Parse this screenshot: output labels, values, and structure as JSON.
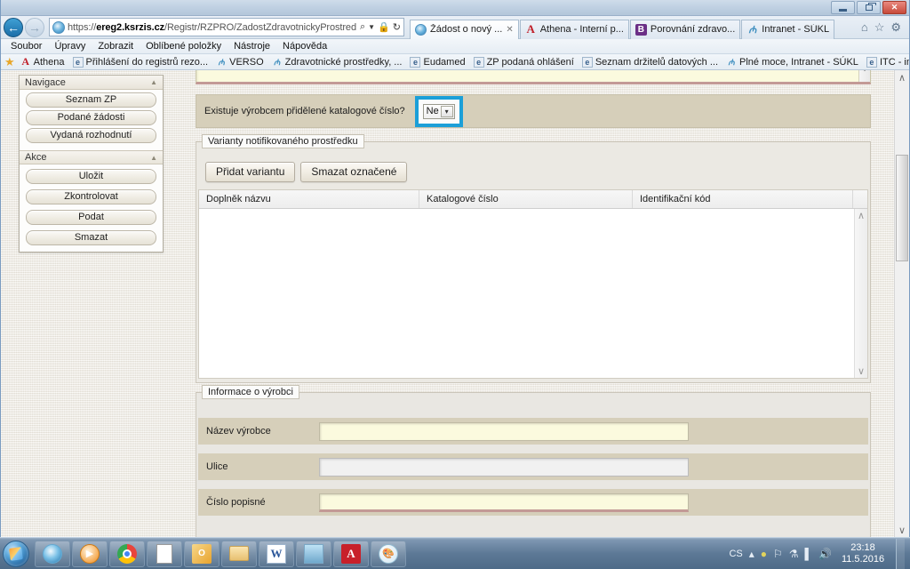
{
  "window": {
    "minimize_label": "—",
    "restore_label": "❐",
    "close_label": "✕"
  },
  "browser": {
    "back_label": "←",
    "forward_label": "→",
    "url_scheme": "https://",
    "url_host": "ereg2.ksrzis.cz",
    "url_path": "/Registr/RZPRO/ZadostZdravotnickyProstredek/NovaZadost",
    "address_icons": {
      "search": "⌕",
      "dropdown": "▾",
      "lock": "ὑ2",
      "refresh": "↻"
    },
    "tabs": [
      {
        "label": "Žádost o nový ...",
        "icon": "ie-icon",
        "active": true,
        "close": "✕"
      },
      {
        "label": "Athena - Interní p...",
        "icon": "athena-a-icon",
        "active": false
      },
      {
        "label": "Porovnání zdravo...",
        "icon": "bing-b-icon",
        "active": false
      },
      {
        "label": "Intranet - SÚKL",
        "icon": "sukl-icon",
        "active": false
      }
    ],
    "toolbar_icons": {
      "home": "⌂",
      "favorites": "☆",
      "settings": "⚙"
    },
    "menu": [
      "Soubor",
      "Úpravy",
      "Zobrazit",
      "Oblíbené položky",
      "Nástroje",
      "Nápověda"
    ],
    "favorites": [
      {
        "label": "Athena",
        "icon": "athena-a-icon"
      },
      {
        "label": "Přihlášení do registrů rezo...",
        "icon": "page-icon"
      },
      {
        "label": "VERSO",
        "icon": "sukl-icon"
      },
      {
        "label": "Zdravotnické prostředky, ...",
        "icon": "sukl-icon"
      },
      {
        "label": "Eudamed",
        "icon": "page-icon"
      },
      {
        "label": "ZP podaná ohlášení",
        "icon": "page-icon"
      },
      {
        "label": "Seznam držitelů datových ...",
        "icon": "page-icon"
      },
      {
        "label": "Plné moce, Intranet - SÚKL",
        "icon": "sukl-icon"
      },
      {
        "label": "ITC - institut pro testování...",
        "icon": "page-icon"
      }
    ]
  },
  "sidebar": {
    "groups": [
      {
        "title": "Navigace",
        "caret": "▲",
        "items": [
          {
            "label": "Seznam ZP"
          },
          {
            "label": "Podané žádosti"
          },
          {
            "label": "Vydaná rozhodnutí"
          }
        ]
      },
      {
        "title": "Akce",
        "caret": "▲",
        "items": [
          {
            "label": "Uložit"
          },
          {
            "label": "Zkontrolovat"
          },
          {
            "label": "Podat"
          },
          {
            "label": "Smazat"
          }
        ]
      }
    ]
  },
  "form": {
    "catalog_row": {
      "label": "Existuje výrobcem přidělené katalogové číslo?",
      "select_value": "Ne",
      "select_arrow": "▾",
      "highlight_color": "#1b9fd8"
    },
    "variants": {
      "legend": "Varianty notifikovaného prostředku",
      "buttons": [
        {
          "label": "Přidat variantu"
        },
        {
          "label": "Smazat označené"
        }
      ],
      "columns": [
        "Doplněk názvu",
        "Katalogové číslo",
        "Identifikační kód"
      ],
      "rows": [],
      "scroll_up": "∧",
      "scroll_down": "∨"
    },
    "manufacturer": {
      "legend": "Informace o výrobci",
      "fields": [
        {
          "label": "Název výrobce",
          "value": "",
          "state": "required"
        },
        {
          "label": "Ulice",
          "value": "",
          "state": "optional"
        },
        {
          "label": "Číslo popisné",
          "value": "",
          "state": "error"
        }
      ]
    }
  },
  "page_scroll": {
    "up": "∧",
    "down": "∨"
  },
  "taskbar": {
    "start_label": "Start",
    "items": [
      {
        "name": "internet-explorer"
      },
      {
        "name": "windows-media-player"
      },
      {
        "name": "google-chrome"
      },
      {
        "name": "document"
      },
      {
        "name": "microsoft-outlook"
      },
      {
        "name": "file-explorer"
      },
      {
        "name": "microsoft-word",
        "glyph": "W"
      },
      {
        "name": "photo-viewer"
      },
      {
        "name": "adobe-reader",
        "glyph": "A"
      },
      {
        "name": "paint",
        "glyph": "Ἲ8"
      }
    ],
    "tray": {
      "language": "CS",
      "icons": [
        "▴",
        "◉",
        "⚑",
        "⛭",
        "▂",
        "ὐA"
      ],
      "time": "23:18",
      "date": "11.5.2016"
    }
  }
}
